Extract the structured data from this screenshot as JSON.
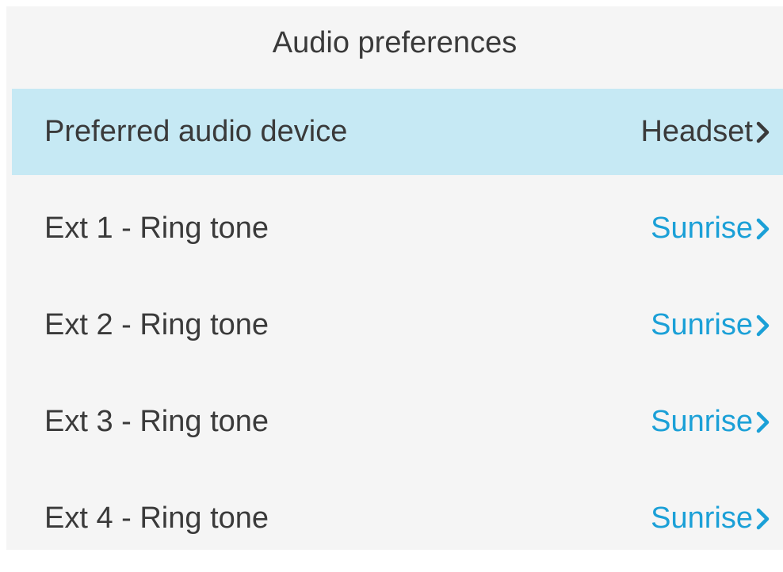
{
  "header": {
    "title": "Audio preferences"
  },
  "colors": {
    "accent": "#1ba0d7",
    "selected_bg": "#c6e9f4",
    "text": "#3a3a3a"
  },
  "items": [
    {
      "label": "Preferred audio device",
      "value": "Headset",
      "selected": true
    },
    {
      "label": "Ext 1 - Ring tone",
      "value": "Sunrise",
      "selected": false
    },
    {
      "label": "Ext 2 - Ring tone",
      "value": "Sunrise",
      "selected": false
    },
    {
      "label": "Ext 3 - Ring tone",
      "value": "Sunrise",
      "selected": false
    },
    {
      "label": "Ext 4 - Ring tone",
      "value": "Sunrise",
      "selected": false
    }
  ],
  "icons": {
    "row_chevron": "chevron-right-icon"
  }
}
